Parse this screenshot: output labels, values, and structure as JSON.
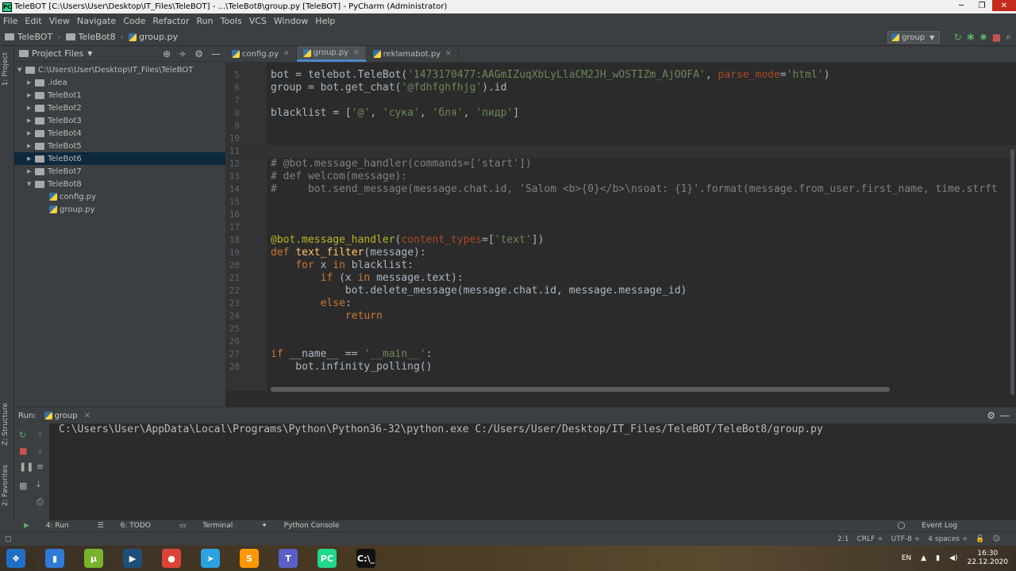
{
  "window": {
    "title": "TeleBOT [C:\\Users\\User\\Desktop\\IT_Files\\TeleBOT] - ...\\TeleBot8\\group.py [TeleBOT] - PyCharm (Administrator)",
    "minimize": "─",
    "maximize": "❐",
    "close": "✕"
  },
  "menu": [
    "File",
    "Edit",
    "View",
    "Navigate",
    "Code",
    "Refactor",
    "Run",
    "Tools",
    "VCS",
    "Window",
    "Help"
  ],
  "breadcrumb": [
    "TeleBOT",
    "TeleBot8",
    "group.py"
  ],
  "run_config": {
    "label": "group"
  },
  "project_panel": {
    "title": "Project Files",
    "root": "C:\\Users\\User\\Desktop\\IT_Files\\TeleBOT",
    "folders": [
      ".idea",
      "TeleBot1",
      "TeleBot2",
      "TeleBot3",
      "TeleBot4",
      "TeleBot5",
      "TeleBot6",
      "TeleBot7",
      "TeleBot8"
    ],
    "files": [
      "config.py",
      "group.py"
    ],
    "selected": "TeleBot6"
  },
  "side_tabs": {
    "project": "1: Project",
    "structure": "Z: Structure",
    "favorites": "2: Favorites"
  },
  "tabs": [
    {
      "label": "config.py"
    },
    {
      "label": "group.py"
    },
    {
      "label": "reklamabot.py"
    }
  ],
  "code_lines": [
    {
      "n": "5",
      "c": "bot = telebot.TeleBot('1473170477:AAGmIZuqXbLyLlaCM2JH_wOSTIZm_AjOOFA', parse_mode='html')"
    },
    {
      "n": "6",
      "c": "group = bot.get_chat('@fdhfghfhjg').id"
    },
    {
      "n": "7",
      "c": ""
    },
    {
      "n": "8",
      "c": "blacklist = ['@', 'сука', 'бля', 'пидр']"
    },
    {
      "n": "9",
      "c": ""
    },
    {
      "n": "10",
      "c": ""
    },
    {
      "n": "11",
      "c": ""
    },
    {
      "n": "12",
      "c": "# @bot.message_handler(commands=['start'])"
    },
    {
      "n": "13",
      "c": "# def welcom(message):"
    },
    {
      "n": "14",
      "c": "#     bot.send_message(message.chat.id, 'Salom <b>{0}</b>\\nsoat: {1}'.format(message.from_user.first_name, time.strft"
    },
    {
      "n": "15",
      "c": ""
    },
    {
      "n": "16",
      "c": ""
    },
    {
      "n": "17",
      "c": ""
    },
    {
      "n": "18",
      "c": "@bot.message_handler(content_types=['text'])"
    },
    {
      "n": "19",
      "c": "def text_filter(message):"
    },
    {
      "n": "20",
      "c": "    for x in blacklist:"
    },
    {
      "n": "21",
      "c": "        if (x in message.text):"
    },
    {
      "n": "22",
      "c": "            bot.delete_message(message.chat.id, message.message_id)"
    },
    {
      "n": "23",
      "c": "        else:"
    },
    {
      "n": "24",
      "c": "            return"
    },
    {
      "n": "25",
      "c": ""
    },
    {
      "n": "26",
      "c": ""
    },
    {
      "n": "27",
      "c": "if __name__ == '__main__':"
    },
    {
      "n": "28",
      "c": "    bot.infinity_polling()"
    }
  ],
  "run_panel": {
    "label": "Run:",
    "tab": "group",
    "output": "C:\\Users\\User\\AppData\\Local\\Programs\\Python\\Python36-32\\python.exe C:/Users/User/Desktop/IT_Files/TeleBOT/TeleBot8/group.py"
  },
  "bottom_tools": [
    "4: Run",
    "6: TODO",
    "Terminal",
    "Python Console"
  ],
  "event_log": "Event Log",
  "status": {
    "position": "2:1",
    "line_sep": "CRLF ÷",
    "encoding": "UTF-8 ÷",
    "indent": "4 spaces ÷"
  },
  "taskbar": {
    "lang": "EN",
    "time": "16:30",
    "date": "22.12.2020",
    "apps": [
      {
        "name": "start",
        "color": "#1f6fc5",
        "glyph": "❖"
      },
      {
        "name": "explorer",
        "color": "#2f7ad6",
        "glyph": "▮"
      },
      {
        "name": "utorrent",
        "color": "#78b32d",
        "glyph": "µ"
      },
      {
        "name": "media",
        "color": "#1f4f7a",
        "glyph": "▶"
      },
      {
        "name": "chrome",
        "color": "#db4437",
        "glyph": "●"
      },
      {
        "name": "telegram",
        "color": "#2aa3e0",
        "glyph": "➤"
      },
      {
        "name": "sublime",
        "color": "#ff9800",
        "glyph": "S"
      },
      {
        "name": "teams",
        "color": "#5b5fc7",
        "glyph": "T"
      },
      {
        "name": "pycharm",
        "color": "#21d789",
        "glyph": "PC"
      },
      {
        "name": "cmd",
        "color": "#111111",
        "glyph": "C:\\_"
      }
    ]
  }
}
